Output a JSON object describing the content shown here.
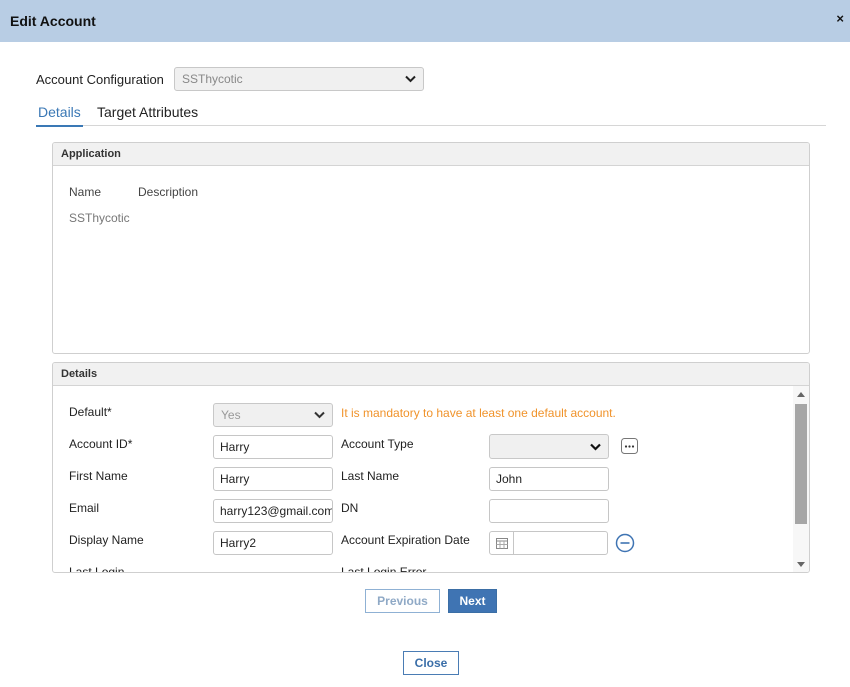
{
  "dialog": {
    "title": "Edit Account",
    "close_glyph": "×"
  },
  "account_configuration": {
    "label": "Account Configuration",
    "value": "SSThycotic"
  },
  "tabs": [
    {
      "label": "Details",
      "active": true
    },
    {
      "label": "Target Attributes",
      "active": false
    }
  ],
  "application_panel": {
    "header": "Application",
    "columns": [
      "Name",
      "Description"
    ],
    "rows": [
      {
        "name": "SSThycotic",
        "description": ""
      }
    ]
  },
  "details_panel": {
    "header": "Details",
    "default_label": "Default*",
    "default_value": "Yes",
    "default_warning": "It is mandatory to have at least one default account.",
    "account_id_label": "Account ID*",
    "account_id_value": "Harry",
    "account_type_label": "Account Type",
    "account_type_value": "",
    "first_name_label": "First Name",
    "first_name_value": "Harry",
    "last_name_label": "Last Name",
    "last_name_value": "John",
    "email_label": "Email",
    "email_value": "harry123@gmail.com",
    "dn_label": "DN",
    "dn_value": "",
    "display_name_label": "Display Name",
    "display_name_value": "Harry2",
    "expiration_label": "Account Expiration Date",
    "expiration_value": "",
    "last_login_label": "Last Login",
    "last_login_error_label": "Last Login Error"
  },
  "buttons": {
    "previous": "Previous",
    "next": "Next",
    "close": "Close"
  },
  "colors": {
    "titlebar": "#b8cde4",
    "accent": "#3f74b3",
    "warning": "#f0932b"
  }
}
